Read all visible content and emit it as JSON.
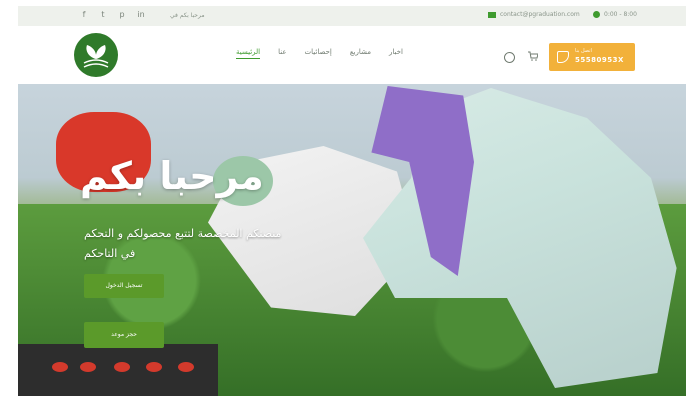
{
  "topbar": {
    "social_icons": [
      "facebook-icon",
      "twitter-icon",
      "pinterest-icon",
      "linkedin-icon"
    ],
    "welcome": "مرحبا بكم في",
    "email": "contact@pgraduation.com",
    "hours": "0:00 - 8:00"
  },
  "header": {
    "nav": [
      {
        "label": "الرئيسية",
        "active": true
      },
      {
        "label": "عنا",
        "active": false
      },
      {
        "label": "إحصائيات",
        "active": false
      },
      {
        "label": "مشاريع",
        "active": false
      },
      {
        "label": "اخبار",
        "active": false
      }
    ],
    "phone_label": "اتصل بنا",
    "phone_number": "55580953X",
    "accent_color": "#f2b13a",
    "brand_color": "#3f9b2f"
  },
  "hero": {
    "title": "مرحبا بكم",
    "subtitle": "منصتكم المخصصة لتتبع محصولكم و التحكم في التاحكم",
    "login_button": "تسجيل الدخول",
    "book_button": "حجز موعد"
  }
}
